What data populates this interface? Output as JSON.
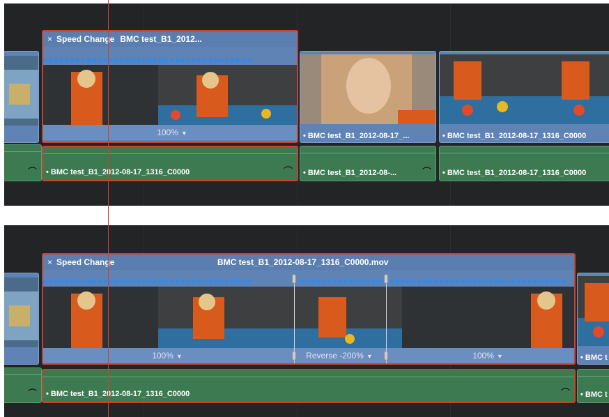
{
  "top": {
    "speed_clip": {
      "x_label": "×",
      "title": "Speed Change",
      "name": "BMC test_B1_2012...",
      "speed": "100%",
      "arrows": "▶▶▶▶▶▶▶▶▶▶▶▶▶▶▶▶▶▶▶▶▶▶▶▶▶▶▶▶▶▶▶▶▶▶▶▶▶▶"
    },
    "video_clips": [
      "• BMC test_B1_2012-08-17_...",
      "• BMC test_B1_2012-08-17_1316_C0000"
    ],
    "audio_clips": [
      "• BMC test_B1_2012-08-17_1316_C0000",
      "• BMC test_B1_2012-08-...",
      "• BMC test_B1_2012-08-17_1316_C0000"
    ]
  },
  "bottom": {
    "speed_clip": {
      "x_label": "×",
      "title": "Speed Change",
      "name": "BMC test_B1_2012-08-17_1316_C0000.mov",
      "arrows_fwd": "▶▶▶▶▶▶▶▶▶▶▶▶▶▶▶▶▶▶▶▶▶▶▶▶▶▶▶▶▶▶▶▶▶▶▶▶▶▶",
      "arrows_rev": "◀◀◀◀◀◀◀◀◀◀◀◀◀◀◀◀◀◀◀◀◀◀◀◀◀◀",
      "arrows_fwd2": "▶▶▶▶▶▶▶▶▶▶▶▶▶▶▶▶▶▶▶▶▶▶▶▶▶▶▶▶▶▶▶▶",
      "speed_1": "100%",
      "speed_2": "Reverse -200%",
      "speed_3": "100%"
    },
    "video_clip_right": "• BMC t",
    "audio_main": "• BMC test_B1_2012-08-17_1316_C0000",
    "audio_right": "• BMC t"
  },
  "colors": {
    "selection": "#c94230",
    "video_clip": "#5f83b4",
    "audio_clip": "#3d7a52",
    "speed_arrows": "#2c8bf0",
    "timeline_bg": "#232426"
  }
}
